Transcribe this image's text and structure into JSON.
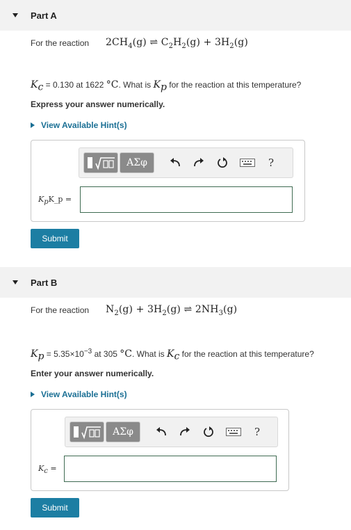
{
  "part_a": {
    "title": "Part A",
    "reaction_label": "For the reaction",
    "kc_symbol": "K",
    "kc_sub": "c",
    "kc_value": " = 0.130 at 1622 ",
    "temp_unit": "°C",
    "question_mid": ". What is ",
    "kp_symbol": "K",
    "kp_sub": "p",
    "question_end": " for the reaction at this temperature?",
    "instruction": "Express your answer numerically.",
    "hint": "View Available Hint(s)",
    "answer_label": "K",
    "answer_label_sub": "p",
    "answer_label_rest": "K_p =",
    "input_value": "",
    "submit": "Submit"
  },
  "part_b": {
    "title": "Part B",
    "reaction_label": "For the reaction",
    "kp_symbol": "K",
    "kp_sub": "p",
    "kp_value": " = 5.35×10",
    "kp_exp": "−3",
    "kp_temp": " at 305 ",
    "temp_unit": "°C",
    "question_mid": ". What is ",
    "kc_symbol": "K",
    "kc_sub": "c",
    "question_end": " for the reaction at this temperature?",
    "instruction": "Enter your answer numerically.",
    "hint": "View Available Hint(s)",
    "answer_label": "K",
    "answer_label_sub": "c",
    "answer_label_rest": " =",
    "input_value": "",
    "submit": "Submit"
  },
  "toolbar": {
    "greek": "ΑΣφ",
    "help": "?"
  },
  "colors": {
    "accent": "#1c7ea3",
    "link": "#1a6f94",
    "header_bg": "#f2f2f2"
  },
  "icons": [
    "template-icon",
    "undo-icon",
    "redo-icon",
    "reset-icon",
    "keyboard-icon",
    "help-icon"
  ]
}
